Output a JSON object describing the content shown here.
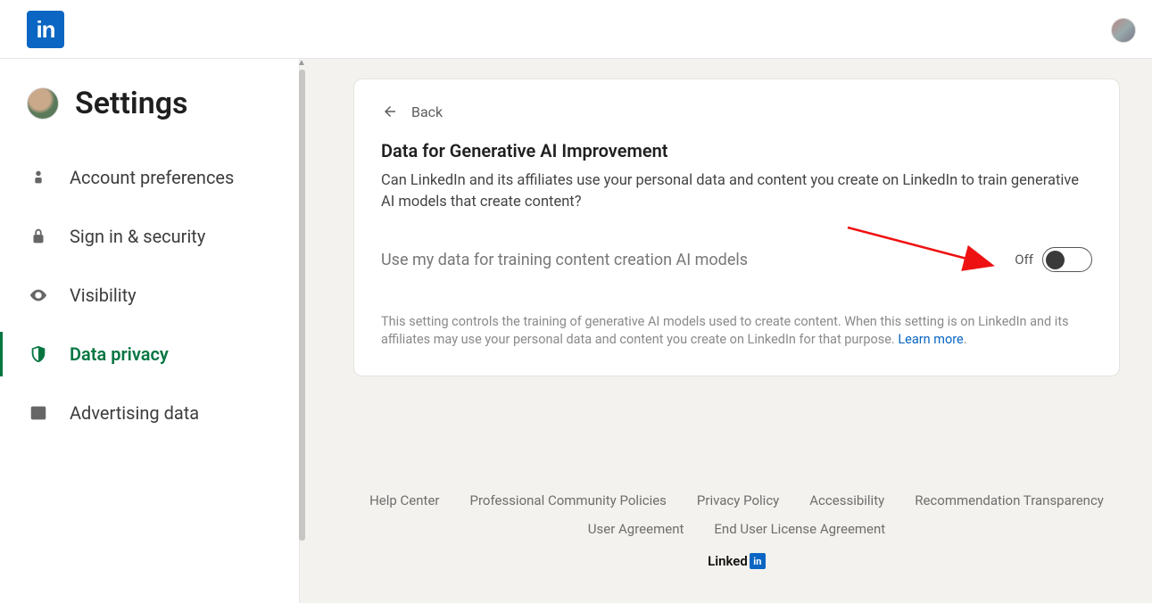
{
  "header": {
    "logo_text": "in"
  },
  "sidebar": {
    "title": "Settings",
    "items": [
      {
        "label": "Account preferences",
        "icon": "person-icon",
        "active": false
      },
      {
        "label": "Sign in & security",
        "icon": "lock-icon",
        "active": false
      },
      {
        "label": "Visibility",
        "icon": "eye-icon",
        "active": false
      },
      {
        "label": "Data privacy",
        "icon": "shield-icon",
        "active": true
      },
      {
        "label": "Advertising data",
        "icon": "newspaper-icon",
        "active": false
      }
    ]
  },
  "main": {
    "back_label": "Back",
    "heading": "Data for Generative AI Improvement",
    "description": "Can LinkedIn and its affiliates use your personal data and content you create on LinkedIn to train generative AI models that create content?",
    "toggle": {
      "label": "Use my data for training content creation AI models",
      "state_text": "Off",
      "on": false
    },
    "fine_print": "This setting controls the training of generative AI models used to create content. When this setting is on LinkedIn and its affiliates may use your personal data and content you create on LinkedIn for that purpose. ",
    "fine_print_link": "Learn more",
    "fine_print_suffix": "."
  },
  "footer": {
    "row1": [
      "Help Center",
      "Professional Community Policies",
      "Privacy Policy",
      "Accessibility",
      "Recommendation Transparency"
    ],
    "row2": [
      "User Agreement",
      "End User License Agreement"
    ],
    "brand_linked": "Linked",
    "brand_in": "in"
  }
}
